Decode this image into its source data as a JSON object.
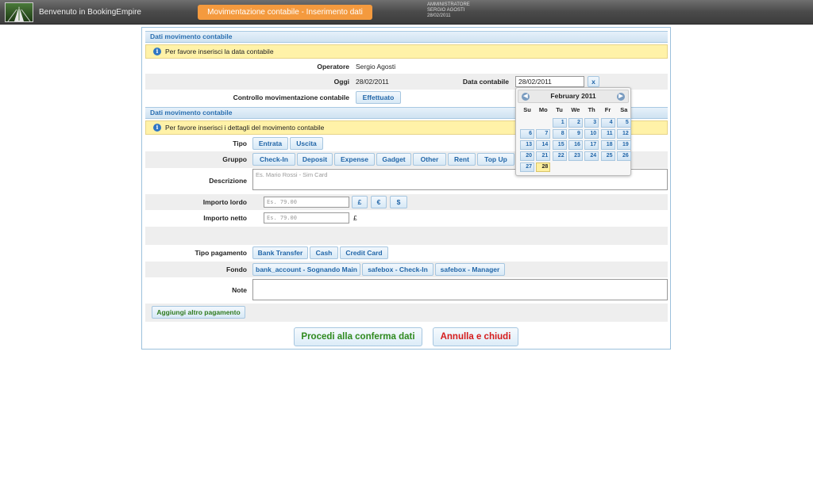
{
  "header": {
    "app_title": "Benvenuto in BookingEmpire",
    "page_badge": "Movimentazione contabile - Inserimento dati",
    "user_role": "AMMINISTRATORE",
    "user_name": "SERGIO AGOSTI",
    "user_date": "28/02/2011"
  },
  "section1": {
    "title": "Dati movimento contabile",
    "notice": "Per favore inserisci la data contabile",
    "operatore_label": "Operatore",
    "operatore_value": "Sergio Agosti",
    "oggi_label": "Oggi",
    "oggi_value": "28/02/2011",
    "data_label": "Data contabile",
    "data_value": "28/02/2011",
    "clear_label": "x",
    "controllo_label": "Controllo movimentazione contabile",
    "controllo_button": "Effettuato"
  },
  "section2": {
    "title": "Dati movimento contabile",
    "notice": "Per favore inserisci i dettagli del movimento contabile",
    "tipo_label": "Tipo",
    "tipo_options": [
      "Entrata",
      "Uscita"
    ],
    "gruppo_label": "Gruppo",
    "gruppo_options": [
      "Check-In",
      "Deposit",
      "Expense",
      "Gadget",
      "Other",
      "Rent",
      "Top Up"
    ],
    "descrizione_label": "Descrizione",
    "descrizione_placeholder": "Es. Mario Rossi - Sim Card",
    "lordo_label": "Importo lordo",
    "lordo_placeholder": "Es. 79.00",
    "currencies": [
      "£",
      "€",
      "$"
    ],
    "netto_label": "Importo netto",
    "netto_placeholder": "Es. 79.00",
    "netto_currency": "£",
    "pagamento_label": "Tipo pagamento",
    "pagamento_options": [
      "Bank Transfer",
      "Cash",
      "Credit Card"
    ],
    "fondo_label": "Fondo",
    "fondo_options": [
      "bank_account - Sognando Main",
      "safebox - Check-In",
      "safebox - Manager"
    ],
    "note_label": "Note",
    "add_payment_button": "Aggiungi altro pagamento"
  },
  "actions": {
    "confirm_button": "Procedi alla conferma dati",
    "cancel_button": "Annulla e chiudi",
    "confirm_color": "#2f8a1e",
    "cancel_color": "#d61c1c"
  },
  "calendar": {
    "month_label": "February 2011",
    "prev_icon": "chevron-left-icon",
    "next_icon": "chevron-right-icon",
    "weekdays": [
      "Su",
      "Mo",
      "Tu",
      "We",
      "Th",
      "Fr",
      "Sa"
    ],
    "first_weekday": 2,
    "days_in_month": 28,
    "selected_day": 28
  }
}
